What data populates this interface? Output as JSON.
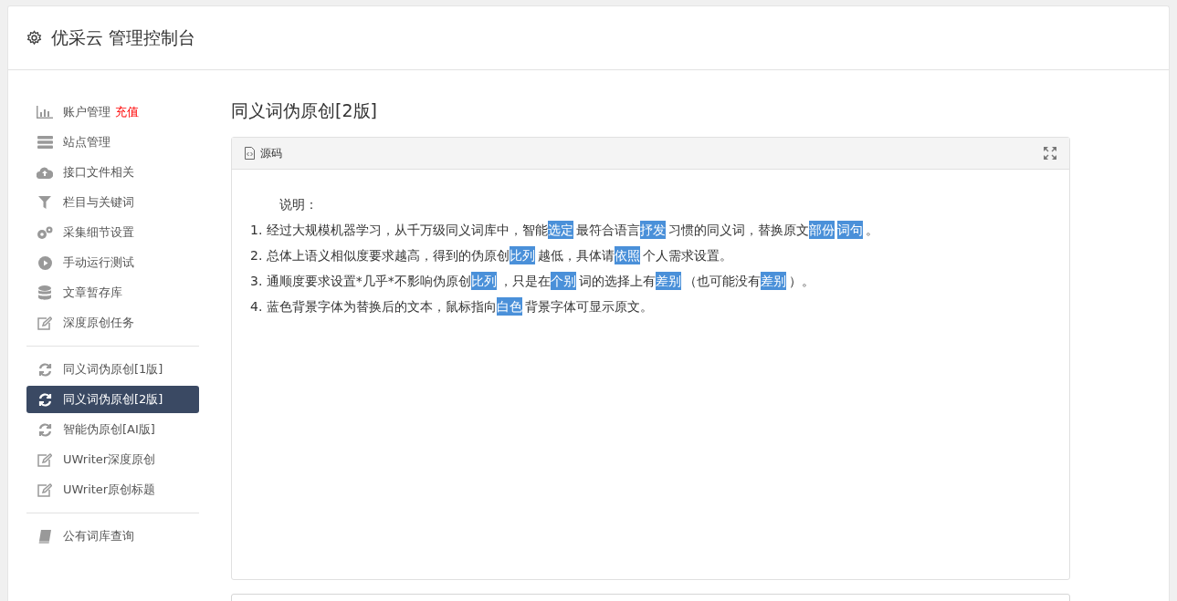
{
  "header": {
    "title": "优采云 管理控制台"
  },
  "sidebar": {
    "groups": [
      [
        {
          "label": "账户管理",
          "badge": "充值",
          "selected": false
        },
        {
          "label": "站点管理",
          "selected": false
        },
        {
          "label": "接口文件相关",
          "selected": false
        },
        {
          "label": "栏目与关键词",
          "selected": false
        },
        {
          "label": "采集细节设置",
          "selected": false
        },
        {
          "label": "手动运行测试",
          "selected": false
        },
        {
          "label": "文章暂存库",
          "selected": false
        },
        {
          "label": "深度原创任务",
          "selected": false
        }
      ],
      [
        {
          "label": "同义词伪原创[1版]",
          "selected": false
        },
        {
          "label": "同义词伪原创[2版]",
          "selected": true
        },
        {
          "label": "智能伪原创[AI版]",
          "selected": false
        },
        {
          "label": "UWriter深度原创",
          "selected": false
        },
        {
          "label": "UWriter原创标题",
          "selected": false
        }
      ],
      [
        {
          "label": "公有词库查询",
          "selected": false
        }
      ]
    ]
  },
  "main": {
    "title": "同义词伪原创[2版]",
    "panel": {
      "tab": "源码",
      "intro": "说明：",
      "lines": [
        [
          {
            "text": "1. 经过大规模机器学习，从千万级同义词库中，智能",
            "highlighted": false
          },
          {
            "text": "选定",
            "highlighted": true
          },
          {
            "text": "最符合语言",
            "highlighted": false
          },
          {
            "text": "抒发",
            "highlighted": true
          },
          {
            "text": "习惯的同义词，替换原文",
            "highlighted": false
          },
          {
            "text": "部份",
            "highlighted": true
          },
          {
            "text": "词句",
            "highlighted": true
          },
          {
            "text": "。",
            "highlighted": false
          }
        ],
        [
          {
            "text": "2. 总体上语义相似度要求越高，得到的伪原创",
            "highlighted": false
          },
          {
            "text": "比列",
            "highlighted": true
          },
          {
            "text": "越低，具体请",
            "highlighted": false
          },
          {
            "text": "依照",
            "highlighted": true
          },
          {
            "text": "个人需求设置。",
            "highlighted": false
          }
        ],
        [
          {
            "text": "3. 通顺度要求设置*几乎*不影响伪原创",
            "highlighted": false
          },
          {
            "text": "比列",
            "highlighted": true
          },
          {
            "text": "，只是在",
            "highlighted": false
          },
          {
            "text": "个别",
            "highlighted": true
          },
          {
            "text": "词的选择上有",
            "highlighted": false
          },
          {
            "text": "差别",
            "highlighted": true
          },
          {
            "text": "（也可能没有",
            "highlighted": false
          },
          {
            "text": "差别",
            "highlighted": true
          },
          {
            "text": "）。",
            "highlighted": false
          }
        ],
        [
          {
            "text": "4. 蓝色背景字体为替换后的文本，鼠标指向",
            "highlighted": false
          },
          {
            "text": "白色",
            "highlighted": true
          },
          {
            "text": "背景字体可显示原文。",
            "highlighted": false
          }
        ]
      ]
    }
  }
}
